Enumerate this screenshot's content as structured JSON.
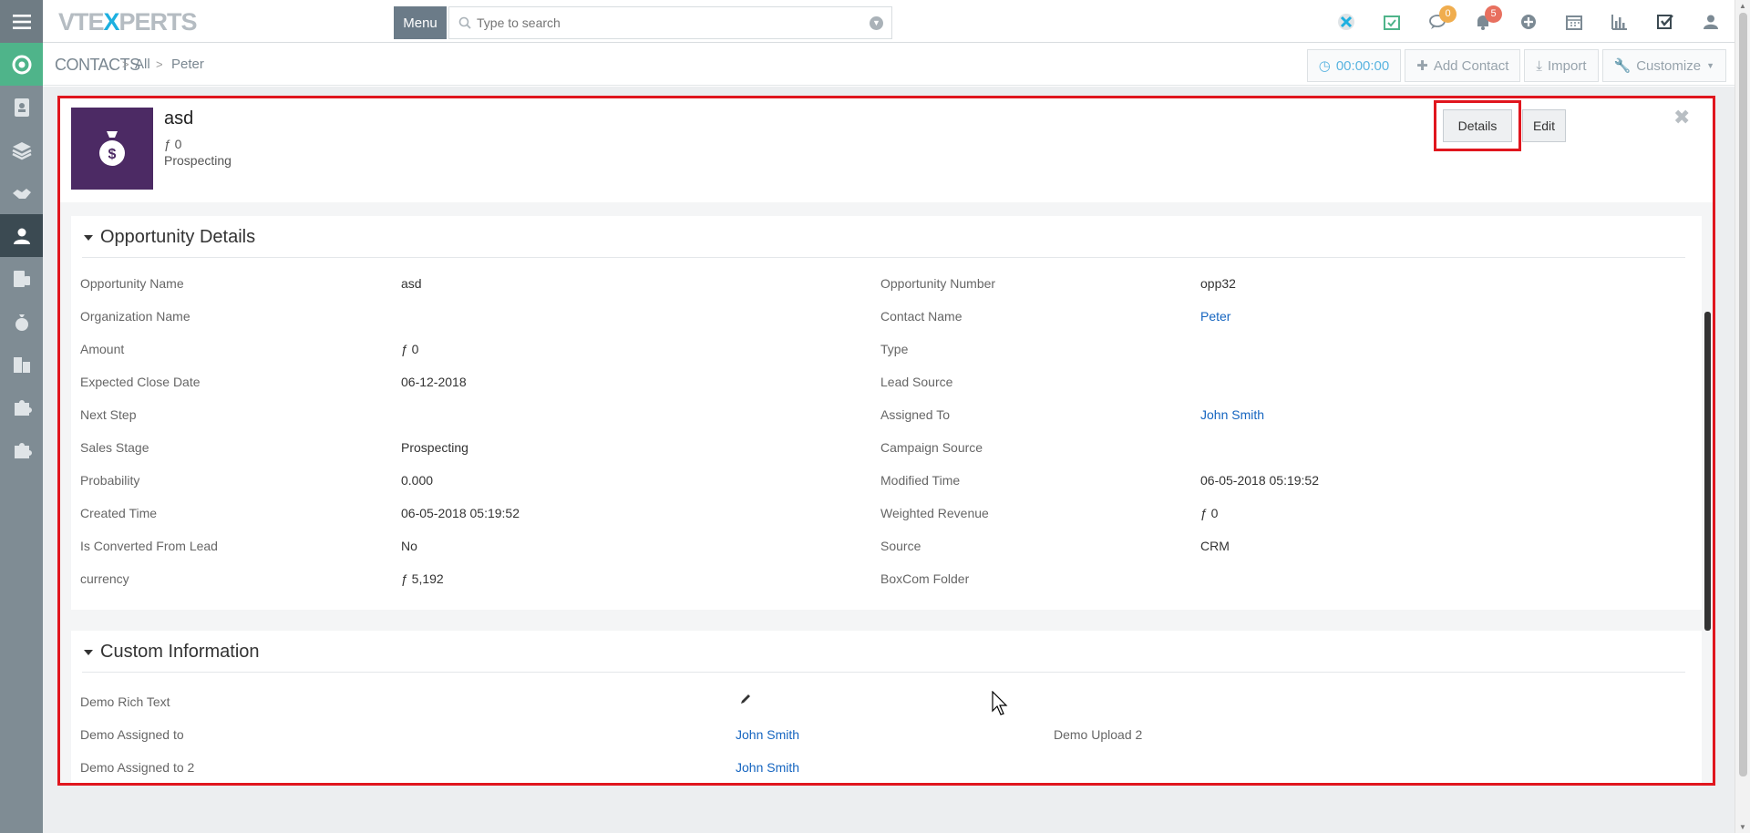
{
  "app": {
    "logo_pre": "VTE",
    "logo_x": "X",
    "logo_post": "PERTS"
  },
  "topbar": {
    "menu_label": "Menu",
    "search_placeholder": "Type to search",
    "chat_badge": "0",
    "bell_badge": "5",
    "badge_colors": {
      "chat": "#f0ad4e",
      "bell": "#e8705f"
    }
  },
  "breadcrumb": {
    "module": "CONTACTS",
    "all": "All",
    "record": "Peter"
  },
  "actions": {
    "timer": "00:00:00",
    "add": "Add Contact",
    "import": "Import",
    "customize": "Customize"
  },
  "record": {
    "title": "asd",
    "amount": "ƒ 0",
    "stage": "Prospecting",
    "details_label": "Details",
    "edit_label": "Edit",
    "close_glyph": "✖"
  },
  "opportunity_block": {
    "title": "Opportunity Details",
    "left": [
      {
        "label": "Opportunity Name",
        "value": "asd"
      },
      {
        "label": "Organization Name",
        "value": ""
      },
      {
        "label": "Amount",
        "value": "ƒ 0"
      },
      {
        "label": "Expected Close Date",
        "value": "06-12-2018"
      },
      {
        "label": "Next Step",
        "value": ""
      },
      {
        "label": "Sales Stage",
        "value": "Prospecting"
      },
      {
        "label": "Probability",
        "value": "0.000"
      },
      {
        "label": "Created Time",
        "value": "06-05-2018 05:19:52"
      },
      {
        "label": "Is Converted From Lead",
        "value": "No"
      },
      {
        "label": "currency",
        "value": "ƒ 5,192"
      }
    ],
    "right": [
      {
        "label": "Opportunity Number",
        "value": "opp32"
      },
      {
        "label": "Contact Name",
        "value": "Peter"
      },
      {
        "label": "Type",
        "value": ""
      },
      {
        "label": "Lead Source",
        "value": ""
      },
      {
        "label": "Assigned To",
        "value": "John Smith"
      },
      {
        "label": "Campaign Source",
        "value": ""
      },
      {
        "label": "Modified Time",
        "value": "06-05-2018 05:19:52"
      },
      {
        "label": "Weighted Revenue",
        "value": "ƒ 0"
      },
      {
        "label": "Source",
        "value": "CRM"
      },
      {
        "label": "BoxCom Folder",
        "value": ""
      }
    ]
  },
  "custom_block": {
    "title": "Custom Information",
    "rows": [
      {
        "label": "Demo Rich Text",
        "value": ""
      },
      {
        "label": "Demo Assigned to",
        "value": "John Smith",
        "extra_label": "Demo Upload 2"
      },
      {
        "label": "Demo Assigned to 2",
        "value": "John Smith"
      }
    ]
  }
}
